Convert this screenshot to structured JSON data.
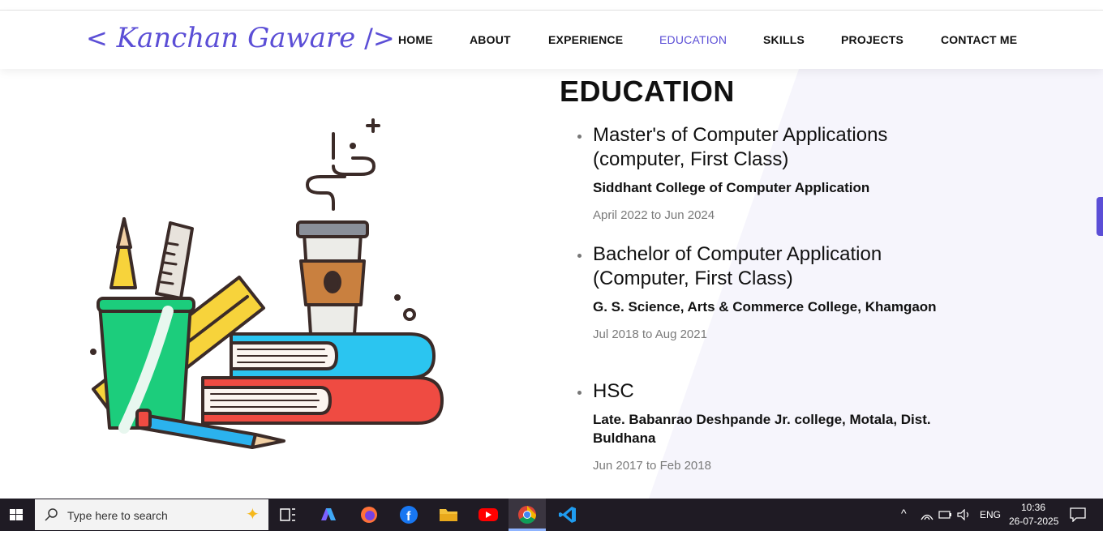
{
  "brand": {
    "logo_text": "Kanchan Gaware",
    "logo_open": "<",
    "logo_close": "/>",
    "accent": "#5b4ed6"
  },
  "nav": {
    "items": [
      {
        "label": "HOME"
      },
      {
        "label": "ABOUT"
      },
      {
        "label": "EXPERIENCE"
      },
      {
        "label": "EDUCATION",
        "active": true
      },
      {
        "label": "SKILLS"
      },
      {
        "label": "PROJECTS"
      },
      {
        "label": "CONTACT ME"
      }
    ]
  },
  "education": {
    "title": "EDUCATION",
    "items": [
      {
        "degree": "Master's of Computer Applications (computer, First Class)",
        "college": "Siddhant College of Computer Application",
        "dates": "April 2022 to Jun 2024"
      },
      {
        "degree": "Bachelor of Computer Application (Computer, First Class)",
        "college": "G. S. Science, Arts & Commerce College, Khamgaon",
        "dates": "Jul 2018 to Aug 2021"
      },
      {
        "degree": "HSC",
        "college": "Late. Babanrao Deshpande Jr. college, Motala, Dist. Buldhana",
        "dates": "Jun 2017 to Feb 2018"
      }
    ]
  },
  "taskbar": {
    "search_placeholder": "Type here to search",
    "apps": [
      "task-view-icon",
      "copilot-icon",
      "firefox-icon",
      "facebook-icon",
      "file-explorer-icon",
      "youtube-icon",
      "chrome-icon",
      "vscode-icon"
    ],
    "tray": {
      "language": "ENG",
      "time": "10:36",
      "date": "26-07-2025"
    }
  }
}
